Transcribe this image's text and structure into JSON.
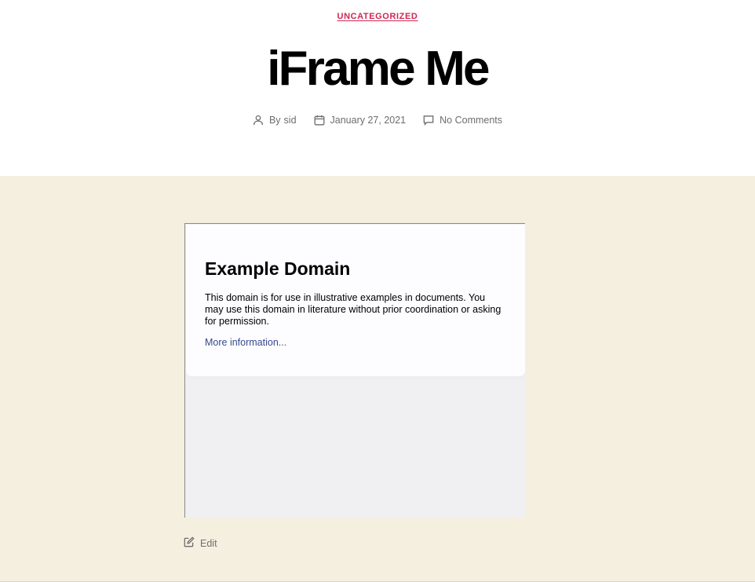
{
  "post": {
    "category": "UNCATEGORIZED",
    "title": "iFrame Me",
    "meta": {
      "author_prefix": "By",
      "author": "sid",
      "date": "January 27, 2021",
      "comments": "No Comments"
    },
    "edit_label": "Edit"
  },
  "embed": {
    "heading": "Example Domain",
    "body": "This domain is for use in illustrative examples in documents. You may use this domain in literature without prior coordination or asking for permission.",
    "link_label": "More information..."
  },
  "colors": {
    "accent": "#cd2653",
    "content_background": "#f5efe0",
    "meta_text": "#6d6d6d",
    "embed_link": "#38488f"
  },
  "icons": [
    "person-icon",
    "calendar-icon",
    "comment-icon",
    "edit-icon"
  ]
}
